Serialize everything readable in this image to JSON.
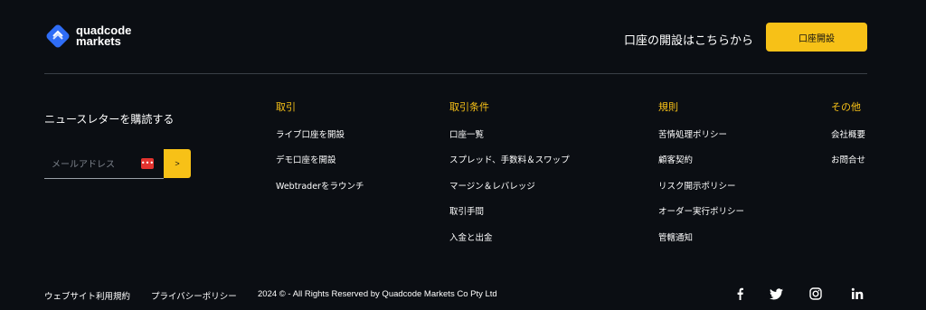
{
  "brand": {
    "logo_line1": "quadcode",
    "logo_line2": "markets"
  },
  "header": {
    "cta_text": "口座の開設はこちらから",
    "open_account_label": "口座開設"
  },
  "newsletter": {
    "title": "ニュースレターを購読する",
    "email_placeholder": "メールアドレス",
    "password_icon_text": "•••",
    "submit_label": ">"
  },
  "columns": [
    {
      "title": "取引",
      "items": [
        "ライブ口座を開設",
        "デモ口座を開設",
        "Webtraderをラウンチ"
      ]
    },
    {
      "title": "取引条件",
      "items": [
        "口座一覧",
        "スプレッド、手数料＆スワップ",
        "マージン＆レバレッジ",
        "取引手間",
        "入金と出金"
      ]
    },
    {
      "title": "規則",
      "items": [
        "苦情処理ポリシー",
        "顧客契約",
        "リスク開示ポリシー",
        "オーダー実行ポリシー",
        "管轄通知"
      ]
    },
    {
      "title": "その他",
      "items": [
        "会社概要",
        "お問合せ"
      ]
    }
  ],
  "footer": {
    "terms_label": "ウェブサイト利用規約",
    "privacy_label": "プライバシーポリシー",
    "copyright": "2024 © - All Rights Reserved by Quadcode Markets Co Pty Ltd"
  },
  "social": [
    "facebook-icon",
    "twitter-icon",
    "instagram-icon",
    "linkedin-icon"
  ],
  "colors": {
    "background": "#0b0e13",
    "accent": "#f7c117",
    "divider": "#3a3f47",
    "badge": "#e3342f"
  }
}
